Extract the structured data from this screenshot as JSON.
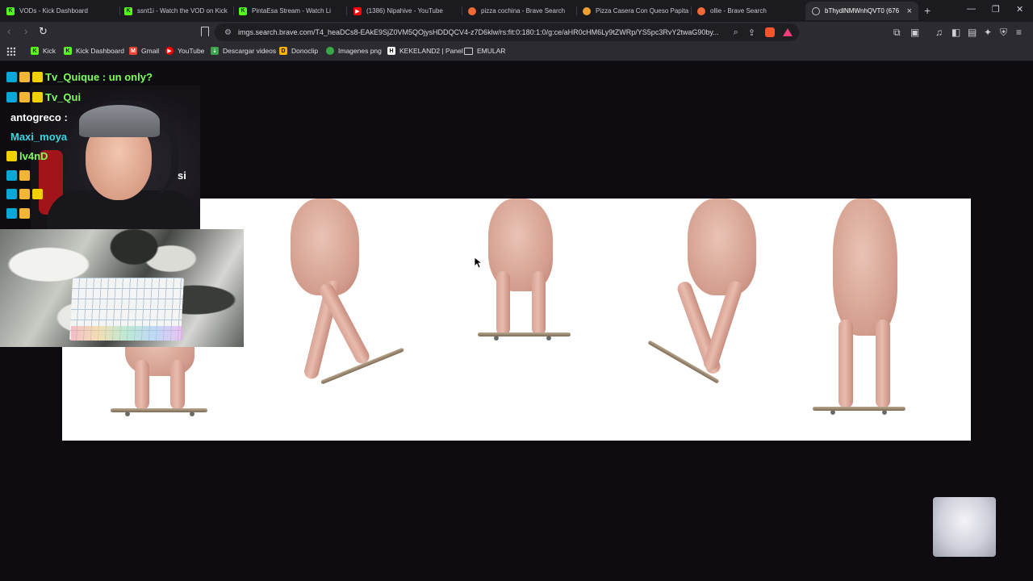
{
  "tabs": [
    {
      "title": "VODs - Kick Dashboard",
      "favicon": "kick-icon",
      "color": "#53fc18",
      "active": false
    },
    {
      "title": "ssnt1i - Watch the VOD on Kick",
      "favicon": "kick-icon",
      "color": "#53fc18",
      "active": false
    },
    {
      "title": "PintaEsa Stream - Watch Li",
      "favicon": "kick-icon",
      "color": "#53fc18",
      "active": false
    },
    {
      "title": "(1386) Nipahive - YouTube",
      "favicon": "youtube-icon",
      "color": "#ff0000",
      "active": false
    },
    {
      "title": "pizza cochina - Brave Search",
      "favicon": "brave-search-icon",
      "color": "#f06a38",
      "active": false
    },
    {
      "title": "Pizza Casera Con Queso Papita",
      "favicon": "brave-search-icon",
      "color": "#f0a030",
      "active": false
    },
    {
      "title": "ollie - Brave Search",
      "favicon": "brave-search-icon",
      "color": "#f06a38",
      "active": false
    },
    {
      "title": "bThydlNMWnhQVT0 (676",
      "favicon": "globe-icon",
      "color": "#c0c0c8",
      "active": true
    }
  ],
  "toolbar": {
    "url": "imgs.search.brave.com/T4_heaDCs8-EAkE9SjZ0VM5QOjysHDDQCV4-z7D6klw/rs:fit:0:180:1:0/g:ce/aHR0cHM6Ly9tZWRp/YS5pc3RvY2twaG90by..."
  },
  "bookmarks": [
    {
      "label": "Kick",
      "icon": "kick-icon",
      "color": "#53fc18"
    },
    {
      "label": "Kick Dashboard",
      "icon": "kick-icon",
      "color": "#53fc18"
    },
    {
      "label": "Gmail",
      "icon": "gmail-icon",
      "color": "#ea4335"
    },
    {
      "label": "YouTube",
      "icon": "youtube-icon",
      "color": "#ff0000"
    },
    {
      "label": "Descargar videos",
      "icon": "download-icon",
      "color": "#3fa34d"
    },
    {
      "label": "Donoclip",
      "icon": "donoclip-icon",
      "color": "#f5b400"
    },
    {
      "label": "Imagenes png",
      "icon": "png-icon",
      "color": "#38a844"
    },
    {
      "label": "KEKELAND2 | Panel",
      "icon": "kekeland-icon",
      "color": "#ffffff"
    },
    {
      "label": "EMULAR",
      "icon": "folder-icon",
      "color": "#cfcdd4"
    }
  ],
  "chat": [
    {
      "text": "Tv_Quique : un only?",
      "color": "#7dff5a"
    },
    {
      "text": "Tv_Qui",
      "color": "#7dff5a"
    },
    {
      "text": "antogreco :",
      "color": "#ffffff"
    },
    {
      "text": "Maxi_moya",
      "color": "#35d8e0"
    },
    {
      "text": "lv4nD",
      "color": "#7dff5a"
    },
    {
      "text": "si",
      "color": "#ffffff"
    }
  ]
}
